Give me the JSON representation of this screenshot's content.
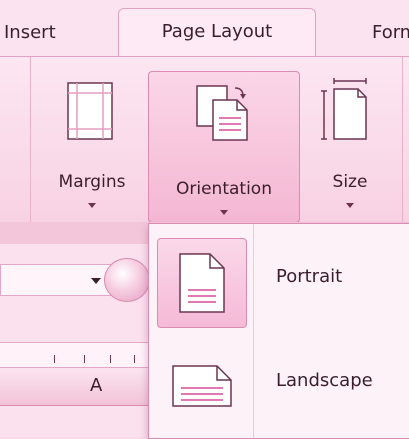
{
  "tabs": {
    "insert": "Insert",
    "active": "Page Layout",
    "next": "Form"
  },
  "ribbon": {
    "margins_label": "Margins",
    "orientation_label": "Orientation",
    "size_label": "Size"
  },
  "sheet": {
    "column_header": "A"
  },
  "dropdown": {
    "portrait_label": "Portrait",
    "landscape_label": "Landscape"
  },
  "colors": {
    "theme_pink": "#f9dcea",
    "accent_border": "#d98bb2",
    "text": "#3a1e2c"
  },
  "icons": [
    "margins-icon",
    "orientation-icon",
    "size-icon",
    "portrait-page-icon",
    "landscape-page-icon"
  ]
}
